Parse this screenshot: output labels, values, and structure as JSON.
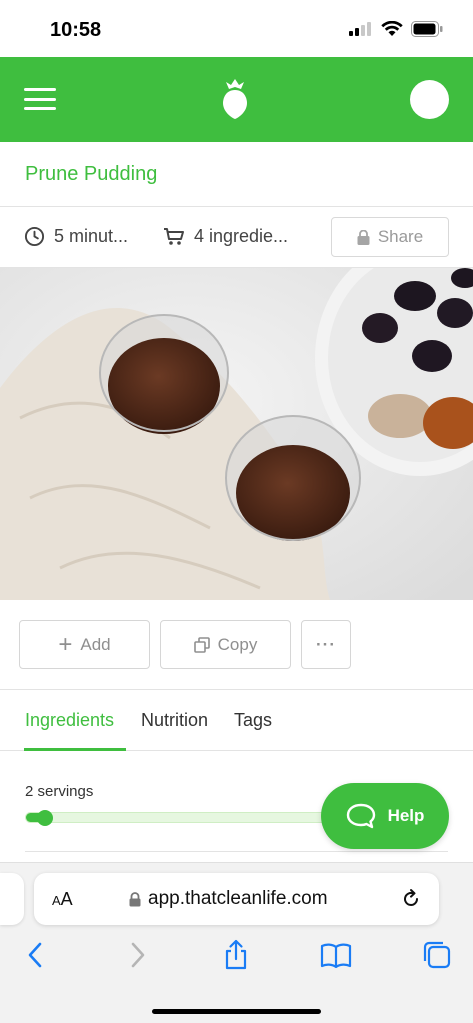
{
  "status_bar": {
    "time": "10:58"
  },
  "header": {
    "menu_icon": "hamburger-icon",
    "logo_icon": "beet-logo-icon",
    "avatar": "avatar"
  },
  "recipe": {
    "title": "Prune Pudding",
    "time": "5 minut...",
    "ingredients_count": "4 ingredie...",
    "share_label": "Share"
  },
  "actions": {
    "add_label": "Add",
    "copy_label": "Copy",
    "more_label": "···"
  },
  "tabs": [
    {
      "label": "Ingredients",
      "active": true
    },
    {
      "label": "Nutrition",
      "active": false
    },
    {
      "label": "Tags",
      "active": false
    }
  ],
  "servings": {
    "label": "2 servings",
    "level": 0.06
  },
  "help": {
    "label": "Help"
  },
  "browser": {
    "aa_small": "A",
    "aa_large": "A",
    "url": "app.thatcleanlife.com"
  },
  "colors": {
    "accent": "#3fbe3f",
    "muted": "#8f8f8f"
  }
}
